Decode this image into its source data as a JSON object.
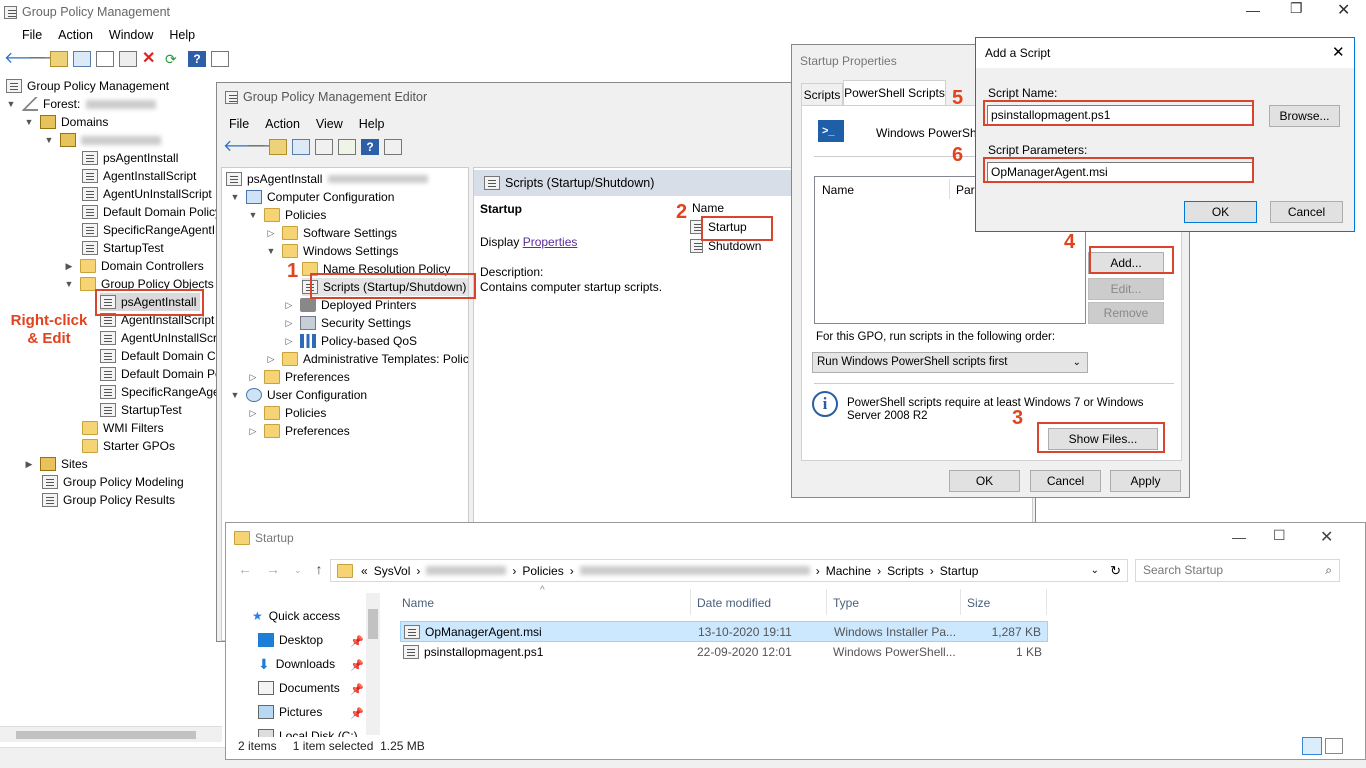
{
  "main": {
    "title": "Group Policy Management",
    "menu": [
      "File",
      "Action",
      "Window",
      "Help"
    ],
    "tree": {
      "root": "Group Policy Management",
      "forest": "Forest:",
      "domains": "Domains",
      "items": [
        "psAgentInstall",
        "AgentInstallScript",
        "AgentUnInstallScript",
        "Default Domain Policy",
        "SpecificRangeAgentIns",
        "StartupTest"
      ],
      "dc": "Domain Controllers",
      "gpo": "Group Policy Objects",
      "gpo_items": [
        "psAgentInstall",
        "AgentInstallScript",
        "AgentUnInstallScri",
        "Default Domain Co",
        "Default Domain Po",
        "SpecificRangeAge",
        "StartupTest"
      ],
      "wmi": "WMI Filters",
      "starter": "Starter GPOs",
      "sites": "Sites",
      "modeling": "Group Policy Modeling",
      "results": "Group Policy Results"
    },
    "annotation": "Right-click\n& Edit"
  },
  "editor": {
    "title": "Group Policy Management Editor",
    "menu": [
      "File",
      "Action",
      "View",
      "Help"
    ],
    "tree": {
      "root": "psAgentInstall",
      "comp": "Computer Configuration",
      "policies": "Policies",
      "software": "Software Settings",
      "windows": "Windows Settings",
      "nrp": "Name Resolution Policy",
      "scripts": "Scripts (Startup/Shutdown)",
      "printers": "Deployed Printers",
      "security": "Security Settings",
      "qos": "Policy-based QoS",
      "admin": "Administrative Templates: Polic",
      "prefs": "Preferences",
      "user": "User Configuration",
      "upolicies": "Policies",
      "uprefs": "Preferences"
    },
    "pane_title": "Scripts (Startup/Shutdown)",
    "section": "Startup",
    "display": "Display",
    "properties_link": "Properties",
    "desc_label": "Description:",
    "desc_text": "Contains computer startup scripts.",
    "name_header": "Name",
    "list": [
      "Startup",
      "Shutdown"
    ]
  },
  "startup_props": {
    "title": "Startup Properties",
    "tabs": [
      "Scripts",
      "PowerShell Scripts"
    ],
    "heading": "Windows PowerShell",
    "col_name": "Name",
    "col_params": "Para",
    "add": "Add...",
    "edit": "Edit...",
    "remove": "Remove",
    "order_label": "For this GPO, run scripts in the following order:",
    "order_value": "Run Windows PowerShell scripts first",
    "info": "PowerShell scripts require at least Windows 7 or Windows Server 2008 R2",
    "show_files": "Show Files...",
    "ok": "OK",
    "cancel": "Cancel",
    "apply": "Apply"
  },
  "add_script": {
    "title": "Add a Script",
    "name_label": "Script Name:",
    "name_value": "psinstallopmagent.ps1",
    "params_label": "Script Parameters:",
    "params_value": "OpManagerAgent.msi",
    "browse": "Browse...",
    "ok": "OK",
    "cancel": "Cancel"
  },
  "explorer": {
    "title": "Startup",
    "path": [
      "«",
      "SysVol",
      "Policies",
      "Machine",
      "Scripts",
      "Startup"
    ],
    "search_placeholder": "Search Startup",
    "nav": [
      "Quick access",
      "Desktop",
      "Downloads",
      "Documents",
      "Pictures",
      "Local Disk (C:)"
    ],
    "columns": [
      "Name",
      "Date modified",
      "Type",
      "Size"
    ],
    "files": [
      {
        "name": "OpManagerAgent.msi",
        "date": "13-10-2020 19:11",
        "type": "Windows Installer Pa...",
        "size": "1,287 KB"
      },
      {
        "name": "psinstallopmagent.ps1",
        "date": "22-09-2020 12:01",
        "type": "Windows PowerShell...",
        "size": "1 KB"
      }
    ],
    "status_items": "2 items",
    "status_sel": "1 item selected",
    "status_size": "1.25 MB"
  },
  "steps": [
    "1",
    "2",
    "3",
    "4",
    "5",
    "6"
  ],
  "colors": {
    "accent": "#0078d7",
    "annotation": "#e2421e",
    "selection": "#cce8ff"
  }
}
